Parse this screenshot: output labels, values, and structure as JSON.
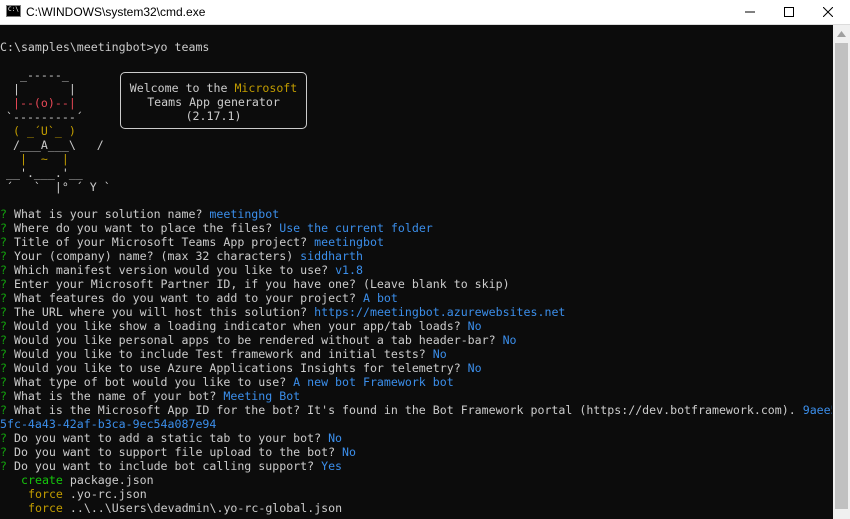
{
  "window": {
    "title": "C:\\WINDOWS\\system32\\cmd.exe",
    "icon": "console-icon",
    "icon_text": "C:\\"
  },
  "console": {
    "prompt_line": "C:\\samples\\meetingbot>yo teams",
    "ascii_art": [
      {
        "text": "  _-----_",
        "color": "#cccccc"
      },
      {
        "text": " |       |",
        "color": "#cccccc"
      },
      {
        "text": " |--(o)--|",
        "color": "#e74856"
      },
      {
        "text": "`---------´",
        "color": "#cccccc"
      },
      {
        "text": " ( _´U`_ )",
        "color": "#c19c00"
      },
      {
        "text": " /___A___\\   /",
        "color": "#cccccc"
      },
      {
        "text": "  |  ~  |",
        "color": "#c19c00"
      },
      {
        "text": "__'.___.'__",
        "color": "#cccccc"
      },
      {
        "text": "´   `  |° ´ Y `",
        "color": "#cccccc"
      }
    ],
    "welcome": {
      "line1_prefix": "Welcome to the ",
      "line1_accent": "Microsoft",
      "line2": "Teams App generator",
      "line3": "(2.17.1)"
    },
    "qa": [
      {
        "q": "What is your solution name? ",
        "a": "meetingbot"
      },
      {
        "q": "Where do you want to place the files? ",
        "a": "Use the current folder"
      },
      {
        "q": "Title of your Microsoft Teams App project? ",
        "a": "meetingbot"
      },
      {
        "q": "Your (company) name? (max 32 characters) ",
        "a": "siddharth"
      },
      {
        "q": "Which manifest version would you like to use? ",
        "a": "v1.8"
      },
      {
        "q": "Enter your Microsoft Partner ID, if you have one? (Leave blank to skip)",
        "a": ""
      },
      {
        "q": "What features do you want to add to your project? ",
        "a": "A bot"
      },
      {
        "q": "The URL where you will host this solution? ",
        "a": "https://meetingbot.azurewebsites.net"
      },
      {
        "q": "Would you like show a loading indicator when your app/tab loads? ",
        "a": "No"
      },
      {
        "q": "Would you like personal apps to be rendered without a tab header-bar? ",
        "a": "No"
      },
      {
        "q": "Would you like to include Test framework and initial tests? ",
        "a": "No"
      },
      {
        "q": "Would you like to use Azure Applications Insights for telemetry? ",
        "a": "No"
      },
      {
        "q": "What type of bot would you like to use? ",
        "a": "A new bot Framework bot"
      },
      {
        "q": "What is the name of your bot? ",
        "a": "Meeting Bot"
      },
      {
        "q": "What is the Microsoft App ID for the bot? It's found in the Bot Framework portal (https://dev.botframework.com). ",
        "a": "9aee5"
      }
    ],
    "wrap_line": "5fc-4a43-42af-b3ca-9ec54a087e94",
    "qa2": [
      {
        "q": "Do you want to add a static tab to your bot? ",
        "a": "No"
      },
      {
        "q": "Do you want to support file upload to the bot? ",
        "a": "No"
      },
      {
        "q": "Do you want to include bot calling support? ",
        "a": "Yes"
      }
    ],
    "question_marker": "?",
    "output": [
      {
        "action": "create",
        "path": "package.json"
      },
      {
        "action": "force",
        "path": ".yo-rc.json"
      },
      {
        "action": "force",
        "path": "..\\..\\Users\\devadmin\\.yo-rc-global.json"
      }
    ]
  },
  "colors": {
    "background": "#0c0c0c",
    "text": "#cccccc",
    "answer": "#3b8eea",
    "question_mark": "#13a10e",
    "action": "#c19c00",
    "create": "#16c60c"
  }
}
